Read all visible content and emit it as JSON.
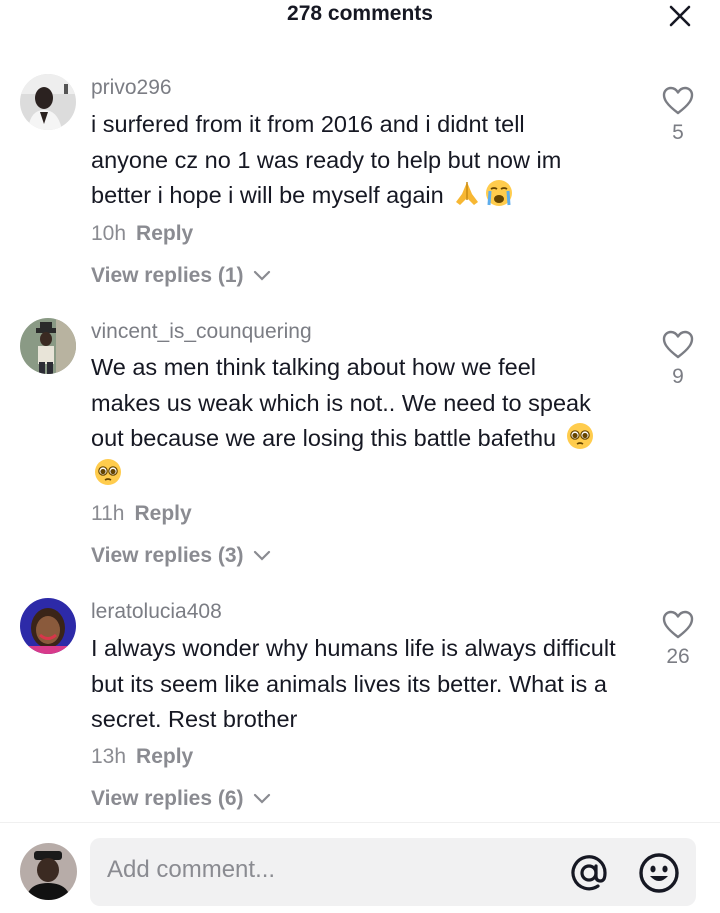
{
  "header": {
    "title": "278 comments",
    "close_icon": "close-icon"
  },
  "comments": [
    {
      "username": "privo296",
      "text": "i surfered from it from 2016 and i didnt tell anyone cz no 1 was ready to help but now im better i hope i will be myself again",
      "emojis": [
        "folded-hands-emoji",
        "loudly-crying-face-emoji"
      ],
      "time": "10h",
      "reply_label": "Reply",
      "view_replies": "View replies (1)",
      "likes": "5"
    },
    {
      "username": "vincent_is_counquering",
      "text": "We as men think talking about how we feel makes us weak which is not.. We need to speak out because we are losing this battle bafethu",
      "emojis": [
        "pleading-face-emoji",
        "pleading-face-emoji"
      ],
      "time": "11h",
      "reply_label": "Reply",
      "view_replies": "View replies (3)",
      "likes": "9"
    },
    {
      "username": "leratolucia408",
      "text": "I always wonder why humans life is always difficult but its seem like animals lives its better. What is a secret. Rest brother",
      "emojis": [],
      "time": "13h",
      "reply_label": "Reply",
      "view_replies": "View replies (6)",
      "likes": "26"
    }
  ],
  "composer": {
    "placeholder": "Add comment...",
    "mention_icon": "at-sign-icon",
    "emoji_icon": "smiley-face-icon"
  },
  "colors": {
    "text_primary": "#161823",
    "text_secondary": "#8a8b91",
    "input_background": "#f1f1f2"
  }
}
